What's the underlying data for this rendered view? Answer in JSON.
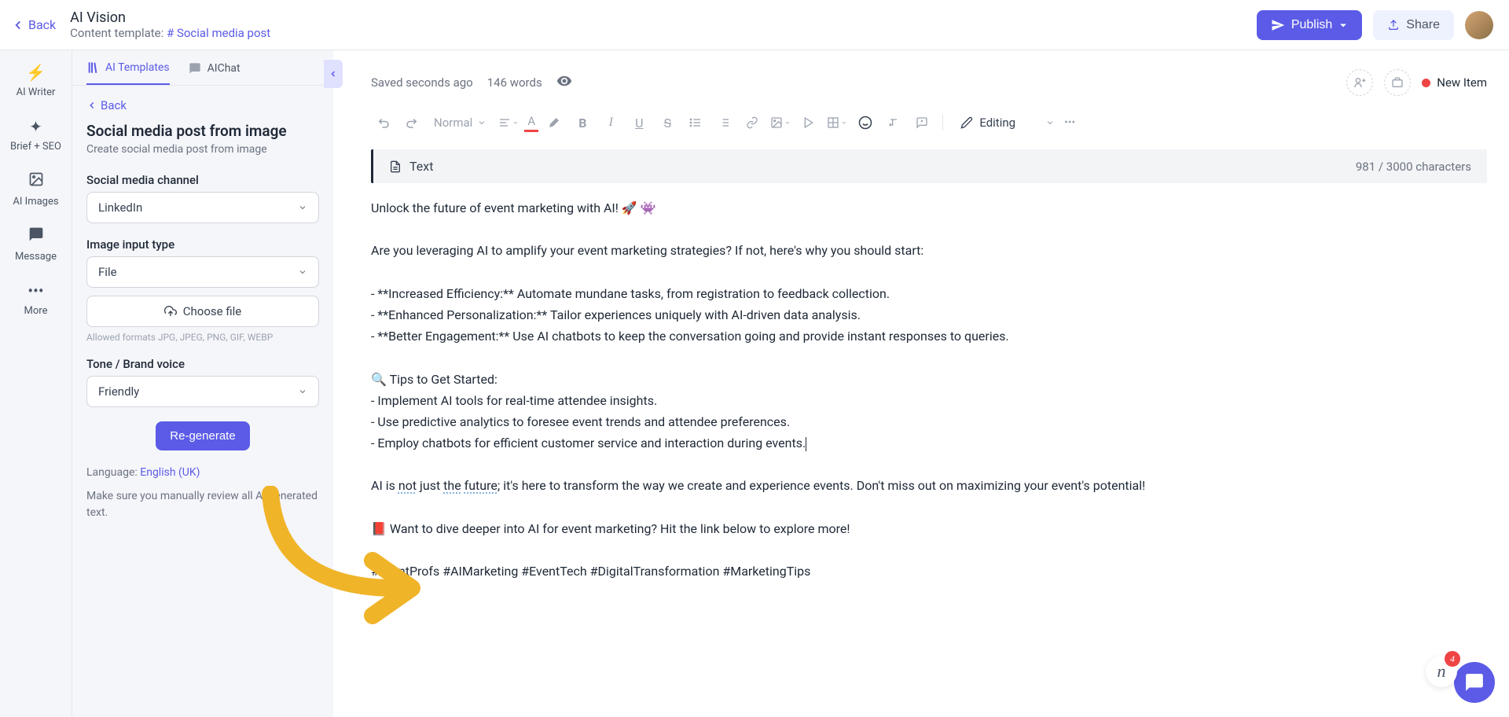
{
  "topbar": {
    "back": "Back",
    "title": "AI Vision",
    "template_label": "Content template:",
    "template_link": "# Social media post",
    "publish": "Publish",
    "share": "Share"
  },
  "rail": [
    {
      "label": "AI Writer"
    },
    {
      "label": "Brief + SEO"
    },
    {
      "label": "AI Images"
    },
    {
      "label": "Message"
    },
    {
      "label": "More"
    }
  ],
  "sidebar": {
    "tabs": {
      "templates": "AI Templates",
      "chat": "AIChat"
    },
    "back": "Back",
    "title": "Social media post from image",
    "subtitle": "Create social media post from image",
    "channel_label": "Social media channel",
    "channel_value": "LinkedIn",
    "input_type_label": "Image input type",
    "input_type_value": "File",
    "choose_file": "Choose file",
    "allowed": "Allowed formats JPG, JPEG, PNG, GIF, WEBP",
    "tone_label": "Tone / Brand voice",
    "tone_value": "Friendly",
    "regenerate": "Re-generate",
    "language_label": "Language:",
    "language_value": "English (UK)",
    "warning": "Make sure you manually review all AI generated text."
  },
  "editor": {
    "saved": "Saved seconds ago",
    "words": "146 words",
    "new_item": "New Item",
    "normal": "Normal",
    "editing": "Editing",
    "text_label": "Text",
    "char_count": "981 / 3000 characters",
    "body": {
      "l1": "Unlock the future of event marketing with AI! 🚀 👾",
      "l2": "Are you leveraging AI to amplify your event marketing strategies? If not, here's why you should start:",
      "l3": "- **Increased Efficiency:** Automate mundane tasks, from registration to feedback collection.",
      "l4": "- **Enhanced Personalization:** Tailor experiences uniquely with AI-driven data analysis.",
      "l5": "- **Better Engagement:** Use AI chatbots to keep the conversation going and provide instant responses to queries.",
      "l6a": "🔍 Tips to Get Started:",
      "l6b": "- Implement AI tools for real-time attendee insights.",
      "l6c": "- Use predictive analytics to foresee event trends and attendee preferences.",
      "l6d": "- Employ chatbots for efficient customer service and interaction during events.",
      "l7_pre": "AI is ",
      "l7_sp1": "not",
      "l7_mid1": " just ",
      "l7_sp2": "the",
      "l7_mid2": " ",
      "l7_sp3": "future",
      "l7_post": "; it's here to transform the way we create and experience events. Don't miss out on maximizing your event's potential!",
      "l8": "📕 Want to dive deeper into AI for event marketing? Hit the link below to explore more!",
      "l9": "#EventProfs #AIMarketing #EventTech #DigitalTransformation #MarketingTips"
    }
  },
  "chat": {
    "badge": "4"
  }
}
